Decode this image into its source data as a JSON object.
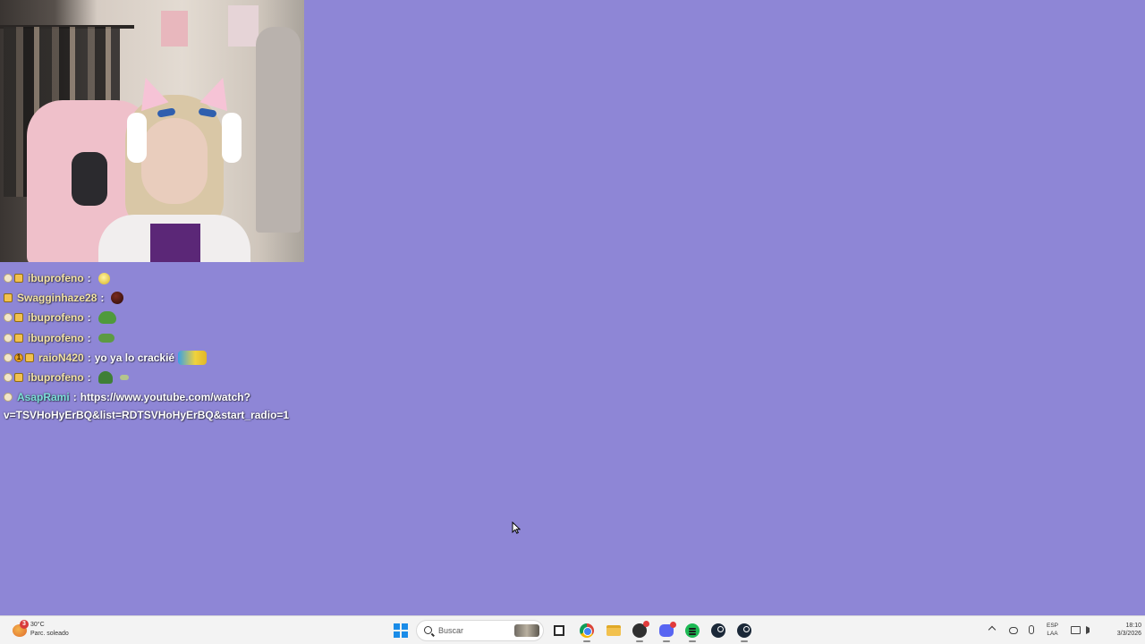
{
  "chat": {
    "messages": [
      {
        "user": "ibuprofeno",
        "sep": ":",
        "text": "",
        "user_color": "#f3e3a4",
        "badges": [
          "dot",
          "crown"
        ],
        "emotes": [
          "smile"
        ]
      },
      {
        "user": "Swagginhaze28",
        "sep": ":",
        "text": "",
        "user_color": "#f3e3a4",
        "badges": [
          "crown"
        ],
        "emotes": [
          "ball"
        ]
      },
      {
        "user": "ibuprofeno",
        "sep": ":",
        "text": "",
        "user_color": "#f3e3a4",
        "badges": [
          "dot",
          "crown"
        ],
        "emotes": [
          "frog"
        ]
      },
      {
        "user": "ibuprofeno",
        "sep": ":",
        "text": "",
        "user_color": "#f3e3a4",
        "badges": [
          "dot",
          "crown"
        ],
        "emotes": [
          "frog-small"
        ]
      },
      {
        "user": "raioN420",
        "sep": ":",
        "text": "yo ya lo crackié",
        "user_color": "#f3e3a4",
        "badges": [
          "dot",
          "num",
          "crown"
        ],
        "badge_num": "1",
        "emotes": [
          "wide"
        ]
      },
      {
        "user": "ibuprofeno",
        "sep": ":",
        "text": "",
        "user_color": "#f3e3a4",
        "badges": [
          "dot",
          "crown"
        ],
        "emotes": [
          "plant",
          "tiny"
        ]
      }
    ],
    "link_message": {
      "user": "AsapRami",
      "sep": ":",
      "user_color": "#7be0d8",
      "line1": "https://www.youtube.com/watch?",
      "line2": "v=TSVHoHyErBQ&list=RDTSVHoHyErBQ&start_radio=1"
    }
  },
  "taskbar": {
    "weather": {
      "badge": "3",
      "temp": "30°C",
      "desc": "Parc. soleado"
    },
    "search_placeholder": "Buscar",
    "apps": [
      "start-icon",
      "search-box",
      "task-view-icon",
      "chrome-icon",
      "file-explorer-icon",
      "obs-icon",
      "discord-icon",
      "spotify-icon",
      "steam-icon",
      "steam-icon"
    ],
    "tray": {
      "lang_line1": "ESP",
      "lang_line2": "LAA",
      "time": "18:10",
      "date": "3/3/2026"
    }
  },
  "colors": {
    "background": "#8e86d6",
    "taskbar": "#f3f3f3",
    "accent": "#1a8ce8"
  }
}
